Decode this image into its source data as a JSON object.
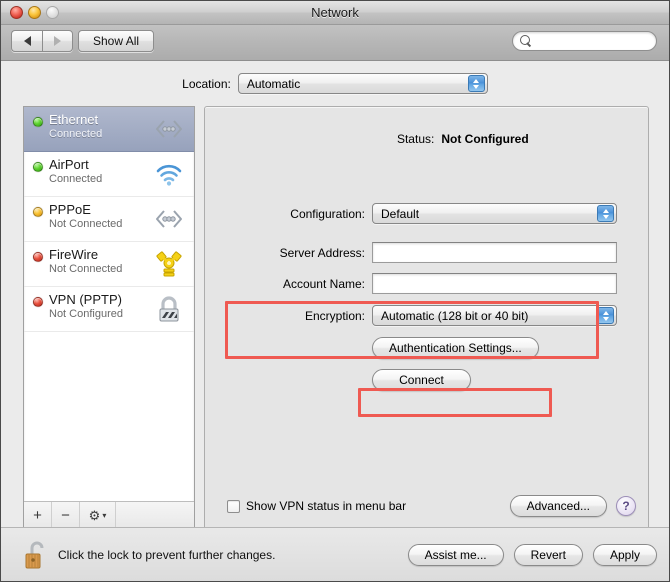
{
  "window": {
    "title": "Network",
    "traffic_lights": [
      "close",
      "minimize",
      "zoom"
    ]
  },
  "toolbar": {
    "back_label": "◀",
    "forward_label": "▶",
    "show_all_label": "Show All",
    "search": {
      "value": "",
      "placeholder": ""
    }
  },
  "location": {
    "label": "Location:",
    "value": "Automatic"
  },
  "sidebar": {
    "services": [
      {
        "name": "Ethernet",
        "status": "Connected",
        "dot": "green",
        "icon": "ethernet-icon",
        "selected": true
      },
      {
        "name": "AirPort",
        "status": "Connected",
        "dot": "green",
        "icon": "airport-wifi-icon",
        "selected": false
      },
      {
        "name": "PPPoE",
        "status": "Not Connected",
        "dot": "yellow",
        "icon": "ethernet-icon",
        "selected": false
      },
      {
        "name": "FireWire",
        "status": "Not Connected",
        "dot": "red",
        "icon": "firewire-icon",
        "selected": false
      },
      {
        "name": "VPN (PPTP)",
        "status": "Not Configured",
        "dot": "red",
        "icon": "vpn-lock-icon",
        "selected": false
      }
    ],
    "toolbar": {
      "add_label": "+",
      "remove_label": "−",
      "gear_label": "⚙",
      "gear_caret": "▾"
    }
  },
  "panel": {
    "status_label": "Status:",
    "status_value": "Not Configured",
    "configuration_label": "Configuration:",
    "configuration_value": "Default",
    "server_address_label": "Server Address:",
    "server_address_value": "",
    "account_name_label": "Account Name:",
    "account_name_value": "",
    "encryption_label": "Encryption:",
    "encryption_value": "Automatic (128 bit or 40 bit)",
    "auth_settings_label": "Authentication Settings...",
    "connect_label": "Connect",
    "show_vpn_status_label": "Show VPN status in menu bar",
    "show_vpn_status_checked": false,
    "advanced_label": "Advanced...",
    "help_label": "?"
  },
  "annotations": {
    "color": "#ef5a52",
    "boxes": [
      {
        "name": "fields-highlight",
        "targets": [
          "Server Address",
          "Account Name"
        ]
      },
      {
        "name": "auth-settings-highlight",
        "targets": [
          "Authentication Settings..."
        ]
      }
    ]
  },
  "bottom_bar": {
    "lock_icon": "unlocked-padlock-icon",
    "lock_text": "Click the lock to prevent further changes.",
    "assist_label": "Assist me...",
    "revert_label": "Revert",
    "apply_label": "Apply"
  }
}
